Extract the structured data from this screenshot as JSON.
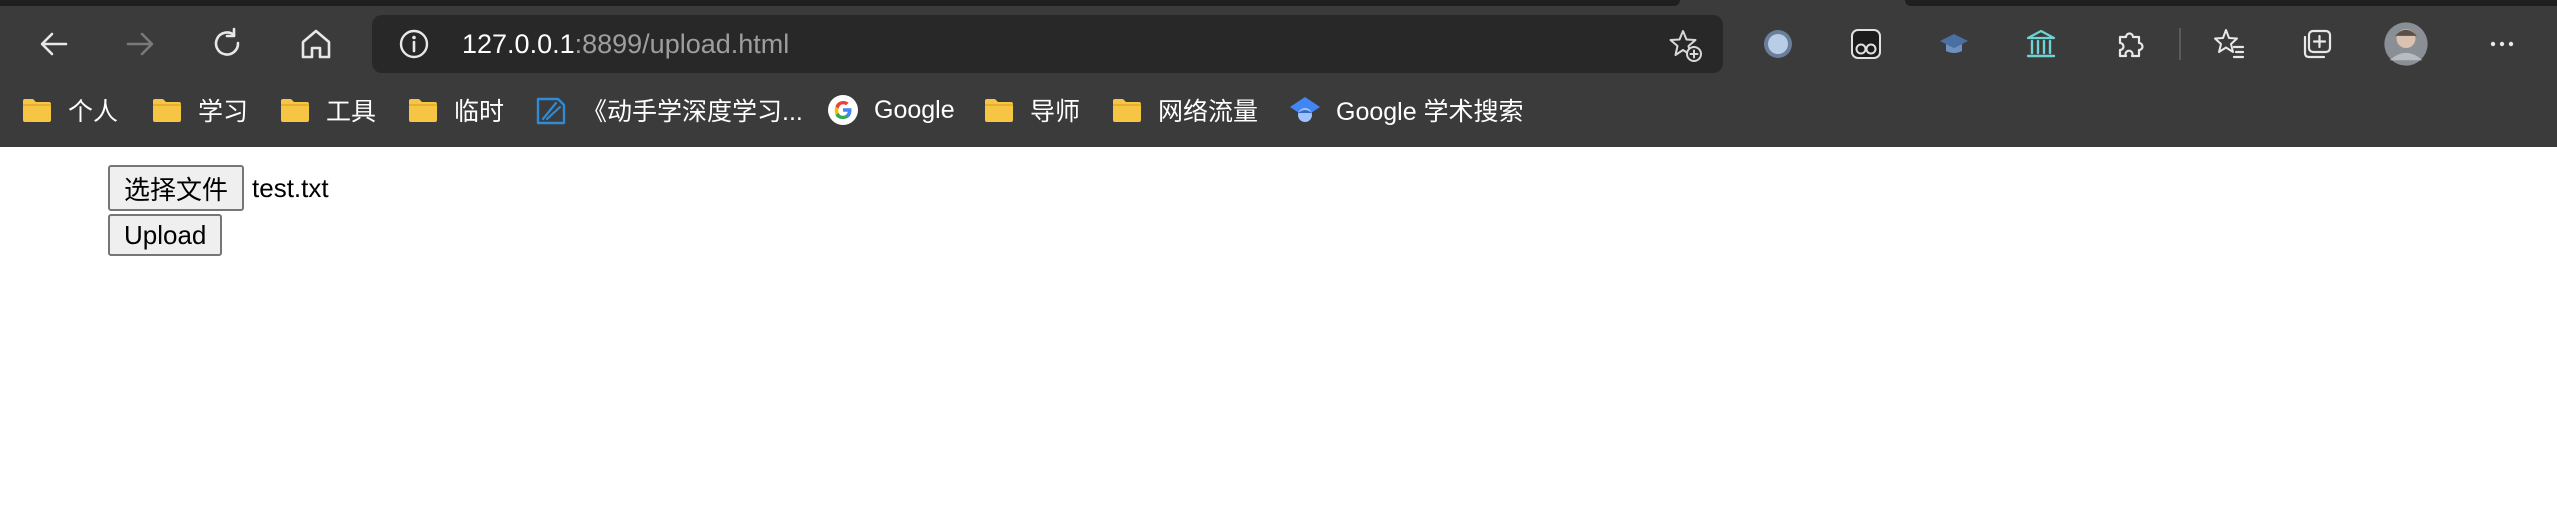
{
  "browser": {
    "address_host": "127.0.0.1",
    "address_rest": ":8899/upload.html",
    "icons": {
      "back": "back-arrow-icon",
      "forward": "forward-arrow-icon",
      "refresh": "refresh-icon",
      "home": "home-icon",
      "info": "info-icon",
      "favorite": "add-favorite-icon",
      "more": "more-dots-icon"
    }
  },
  "bookmarks": [
    {
      "label": "个人",
      "icon": "folder-icon"
    },
    {
      "label": "学习",
      "icon": "folder-icon"
    },
    {
      "label": "工具",
      "icon": "folder-icon"
    },
    {
      "label": "临时",
      "icon": "folder-icon"
    },
    {
      "label": "《动手学深度学习...",
      "icon": "book-icon"
    },
    {
      "label": "Google",
      "icon": "google-icon"
    },
    {
      "label": "导师",
      "icon": "folder-icon"
    },
    {
      "label": "网络流量",
      "icon": "folder-icon"
    },
    {
      "label": "Google 学术搜索",
      "icon": "scholar-icon"
    }
  ],
  "page": {
    "choose_file_label": "选择文件",
    "file_name": "test.txt",
    "upload_label": "Upload"
  },
  "colors": {
    "toolbar": "#3b3b3b",
    "address_bar": "#282828",
    "folder": "#f6c544",
    "page_bg": "#ffffff"
  }
}
